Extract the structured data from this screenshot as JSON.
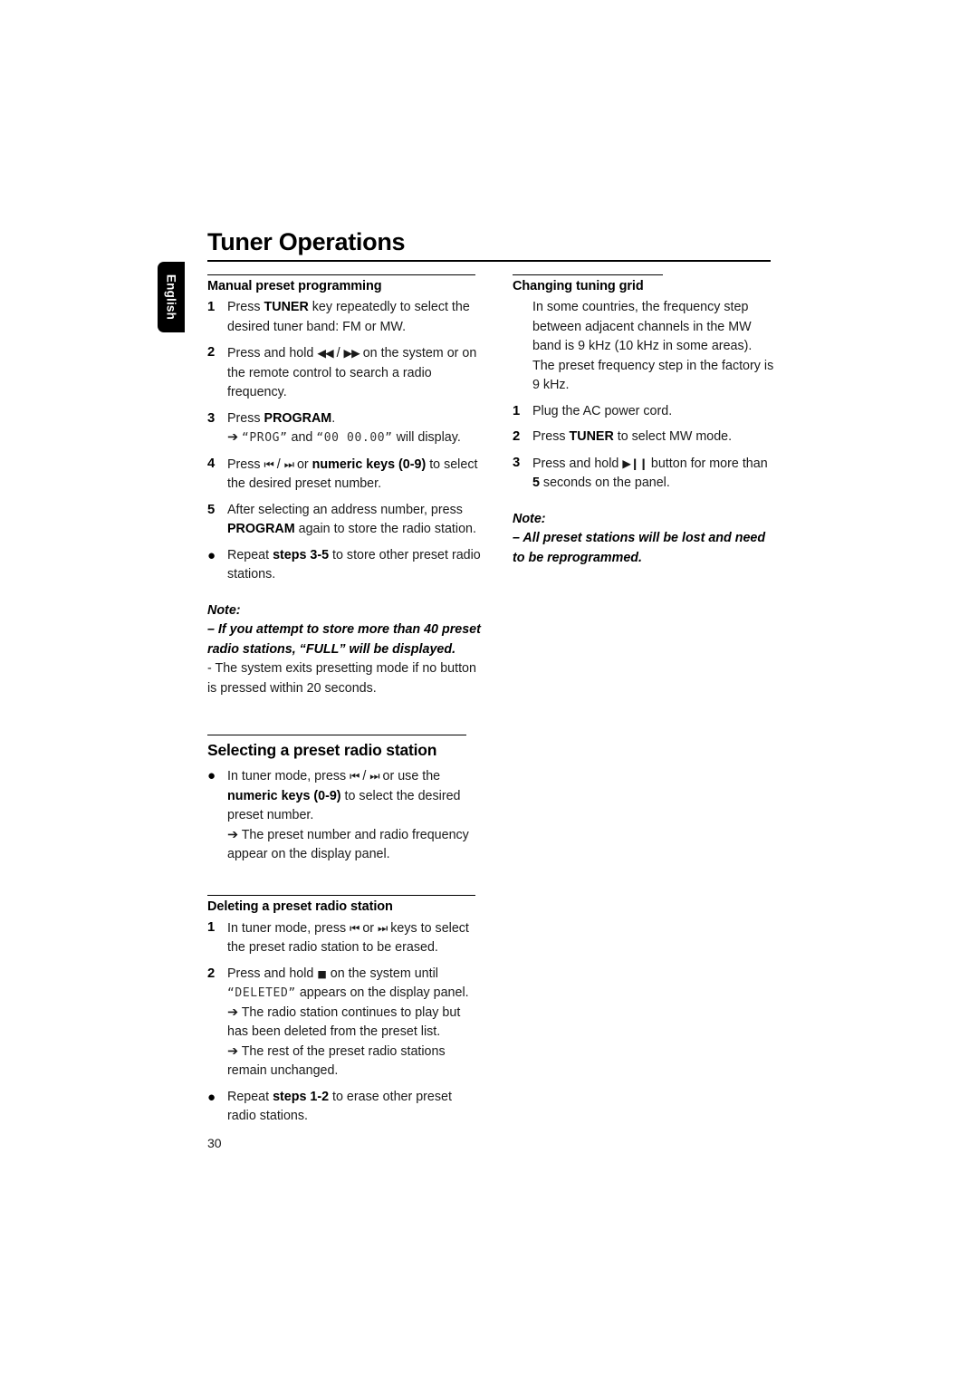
{
  "page": {
    "language_tab": "English",
    "title": "Tuner Operations",
    "page_number": "30"
  },
  "left_column": {
    "section1": {
      "heading": "Manual preset programming",
      "steps": [
        {
          "marker": "1",
          "parts": [
            {
              "t": "Press ",
              "s": "n"
            },
            {
              "t": "TUNER",
              "s": "b"
            },
            {
              "t": " key repeatedly to select the desired tuner band: FM or MW.",
              "s": "n"
            }
          ]
        },
        {
          "marker": "2",
          "parts": [
            {
              "t": "Press and hold ",
              "s": "n"
            },
            {
              "t": "◀◀",
              "s": "g"
            },
            {
              "t": " / ",
              "s": "n"
            },
            {
              "t": "▶▶",
              "s": "g"
            },
            {
              "t": " on the system or on the remote control to search a radio frequency.",
              "s": "n"
            }
          ]
        },
        {
          "marker": "3",
          "parts": [
            {
              "t": "Press ",
              "s": "n"
            },
            {
              "t": "PROGRAM",
              "s": "b"
            },
            {
              "t": ".",
              "s": "n"
            }
          ],
          "sub": [
            {
              "t": "➔ ",
              "s": "n"
            },
            {
              "t": "“PROG”",
              "s": "lcd"
            },
            {
              "t": " and ",
              "s": "n"
            },
            {
              "t": "“00  00.00”",
              "s": "lcd"
            },
            {
              "t": " will display.",
              "s": "n"
            }
          ]
        },
        {
          "marker": "4",
          "parts": [
            {
              "t": "Press ",
              "s": "n"
            },
            {
              "t": "⏮",
              "s": "g"
            },
            {
              "t": " / ",
              "s": "n"
            },
            {
              "t": "⏭",
              "s": "g"
            },
            {
              "t": " or ",
              "s": "n"
            },
            {
              "t": "numeric keys (0-9)",
              "s": "b"
            },
            {
              "t": " to select the desired preset number.",
              "s": "n"
            }
          ]
        },
        {
          "marker": "5",
          "parts": [
            {
              "t": "After selecting an address number, press ",
              "s": "n"
            },
            {
              "t": "PROGRAM",
              "s": "b"
            },
            {
              "t": " again to store the radio station.",
              "s": "n"
            }
          ]
        },
        {
          "marker": "●",
          "parts": [
            {
              "t": "Repeat ",
              "s": "n"
            },
            {
              "t": "steps 3-5",
              "s": "b"
            },
            {
              "t": " to store other preset radio stations.",
              "s": "n"
            }
          ]
        }
      ],
      "note_label": "Note:",
      "note_lines": [
        {
          "t": "–  If you attempt to store more than 40 preset radio stations, “FULL” will be displayed.",
          "s": "ib"
        },
        {
          "t": "-  The system exits presetting mode if no button is pressed within 20 seconds.",
          "s": "n"
        }
      ]
    },
    "section2": {
      "heading": "Selecting a preset radio station",
      "steps": [
        {
          "marker": "●",
          "parts": [
            {
              "t": "In tuner mode, press ",
              "s": "n"
            },
            {
              "t": "⏮",
              "s": "g"
            },
            {
              "t": " / ",
              "s": "n"
            },
            {
              "t": "⏭",
              "s": "g"
            },
            {
              "t": " or use the ",
              "s": "n"
            },
            {
              "t": "numeric keys (0-9)",
              "s": "b"
            },
            {
              "t": " to select the desired preset number.",
              "s": "n"
            }
          ],
          "sub": [
            {
              "t": "➔ The preset number and radio frequency appear on the display panel.",
              "s": "n"
            }
          ]
        }
      ]
    },
    "section3": {
      "heading": "Deleting a preset radio station",
      "steps": [
        {
          "marker": "1",
          "parts": [
            {
              "t": "In tuner mode, press ",
              "s": "n"
            },
            {
              "t": "⏮",
              "s": "g"
            },
            {
              "t": " or ",
              "s": "n"
            },
            {
              "t": "⏭",
              "s": "g"
            },
            {
              "t": " keys to select the preset radio station to be erased.",
              "s": "n"
            }
          ]
        },
        {
          "marker": "2",
          "parts": [
            {
              "t": "Press and hold ",
              "s": "n"
            },
            {
              "t": "■",
              "s": "gs"
            },
            {
              "t": " on the system until ",
              "s": "n"
            },
            {
              "t": "“DELETED”",
              "s": "lcd"
            },
            {
              "t": " appears on the display panel.",
              "s": "n"
            }
          ],
          "sub": [
            {
              "t": "➔ The radio station continues to play but has been deleted from the preset list.",
              "s": "n"
            }
          ],
          "sub2": [
            {
              "t": "➔ The rest of the preset radio stations remain unchanged.",
              "s": "n"
            }
          ]
        },
        {
          "marker": "●",
          "parts": [
            {
              "t": "Repeat ",
              "s": "n"
            },
            {
              "t": "steps 1-2",
              "s": "b"
            },
            {
              "t": " to erase other preset radio stations.",
              "s": "n"
            }
          ]
        }
      ]
    }
  },
  "right_column": {
    "section1": {
      "heading": "Changing tuning grid",
      "intro": "In some countries, the frequency step between adjacent channels in the MW band is 9 kHz (10 kHz in some areas). The preset frequency step in the factory is 9 kHz.",
      "steps": [
        {
          "marker": "1",
          "parts": [
            {
              "t": "Plug the AC power cord.",
              "s": "n"
            }
          ]
        },
        {
          "marker": "2",
          "parts": [
            {
              "t": "Press ",
              "s": "n"
            },
            {
              "t": "TUNER",
              "s": "b"
            },
            {
              "t": " to select MW mode.",
              "s": "n"
            }
          ]
        },
        {
          "marker": "3",
          "parts": [
            {
              "t": "Press and hold ",
              "s": "n"
            },
            {
              "t": "▶❙❙",
              "s": "g"
            },
            {
              "t": " button for more than ",
              "s": "n"
            },
            {
              "t": "5",
              "s": "b"
            },
            {
              "t": " seconds on the panel.",
              "s": "n"
            }
          ]
        }
      ],
      "note_label": "Note:",
      "note_lines": [
        {
          "t": "–  All preset stations will be lost and need to be reprogrammed.",
          "s": "ib"
        }
      ]
    }
  }
}
